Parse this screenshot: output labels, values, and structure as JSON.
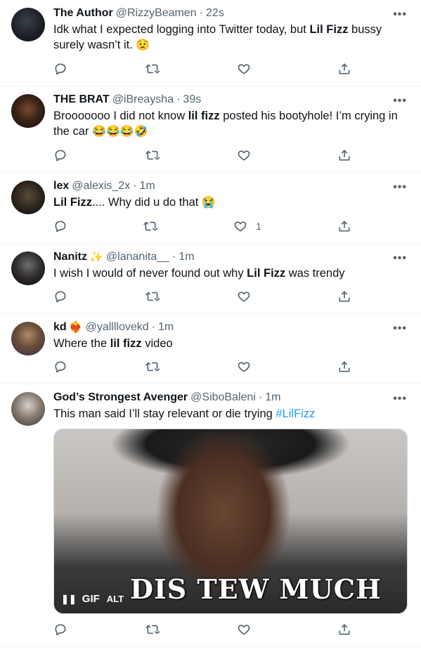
{
  "tweets": [
    {
      "name": "The Author",
      "handle": "@RizzyBeamen",
      "time": "22s",
      "text": [
        {
          "t": "Idk what I expected logging into Twitter today, but "
        },
        {
          "t": "Lil Fizz",
          "b": true
        },
        {
          "t": " bussy surely wasn’t it. "
        },
        {
          "t": "😟",
          "e": true
        }
      ],
      "likes": ""
    },
    {
      "name": "THE BRAT",
      "handle": "@iBreaysha",
      "time": "39s",
      "text": [
        {
          "t": "Brooooooo I did not know "
        },
        {
          "t": "lil fizz",
          "b": true
        },
        {
          "t": " posted his bootyhole! I’m crying in the car "
        },
        {
          "t": "😂😂😂🤣",
          "e": true
        }
      ],
      "likes": ""
    },
    {
      "name": "lex",
      "handle": "@alexis_2x",
      "time": "1m",
      "text": [
        {
          "t": "Lil Fizz",
          "b": true
        },
        {
          "t": ".... Why did u do that "
        },
        {
          "t": "😭",
          "e": true
        }
      ],
      "likes": "1"
    },
    {
      "name": "Nanitz",
      "name_emoji": "✨",
      "handle": "@lananita__",
      "time": "1m",
      "text": [
        {
          "t": "I wish I would of never found out why "
        },
        {
          "t": "Lil Fizz",
          "b": true
        },
        {
          "t": " was trendy"
        }
      ],
      "likes": ""
    },
    {
      "name": "kd",
      "name_emoji": "❤️‍🔥",
      "handle": "@yallllovekd",
      "time": "1m",
      "text": [
        {
          "t": "Where the "
        },
        {
          "t": "lil fizz",
          "b": true
        },
        {
          "t": " video"
        }
      ],
      "likes": ""
    },
    {
      "name": "God’s Strongest Avenger",
      "handle": "@SiboBaleni",
      "time": "1m",
      "text": [
        {
          "t": "This man said I’ll stay relevant or die trying "
        },
        {
          "t": "#LilFizz",
          "h": true
        }
      ],
      "media": {
        "badge": "GIF",
        "alt": "ALT",
        "caption": "DIS TEW MUCH"
      },
      "likes": ""
    }
  ],
  "colors": {
    "accent": "#1d9bf0",
    "secondary_text": "#536471",
    "divider": "#eff3f4"
  },
  "icons": [
    "reply-icon",
    "retweet-icon",
    "like-icon",
    "share-icon",
    "more-icon",
    "pause-icon"
  ]
}
